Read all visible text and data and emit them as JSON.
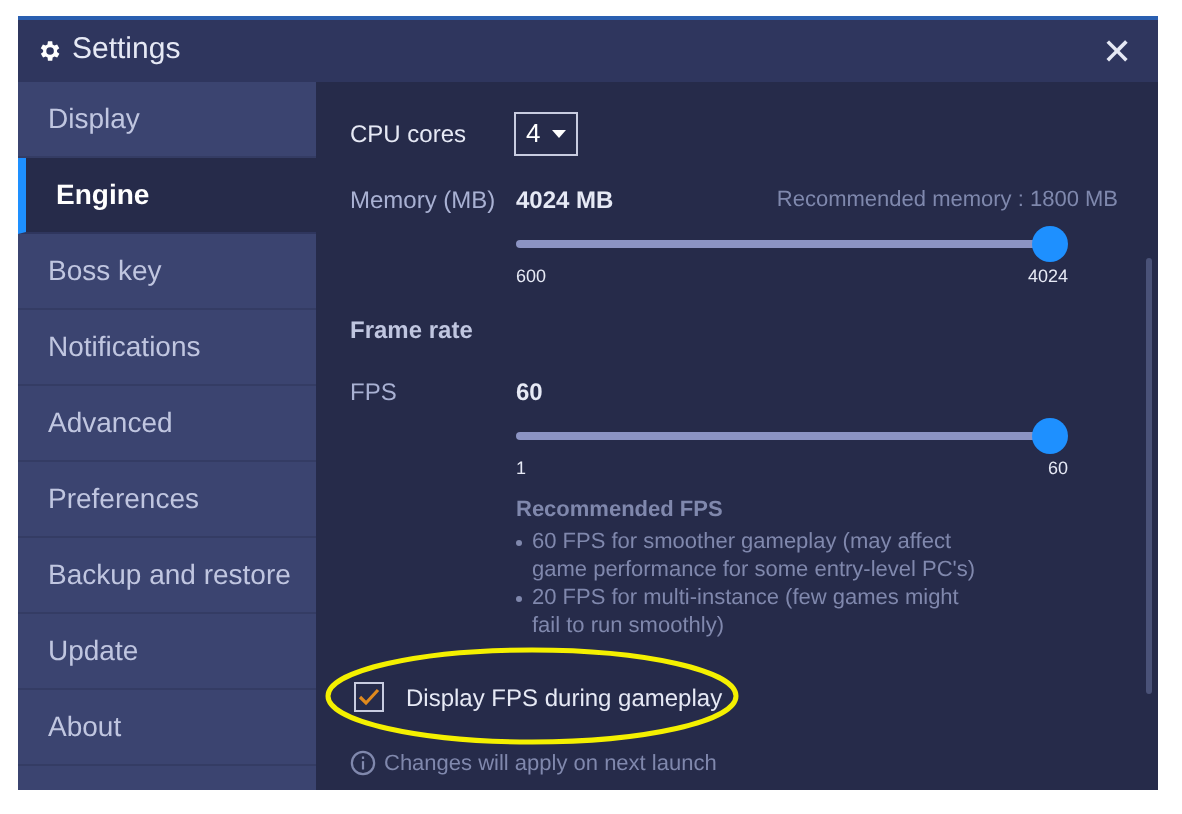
{
  "window": {
    "title": "Settings",
    "close": "✕"
  },
  "sidebar": {
    "items": [
      {
        "label": "Display",
        "selected": false
      },
      {
        "label": "Engine",
        "selected": true
      },
      {
        "label": "Boss key",
        "selected": false
      },
      {
        "label": "Notifications",
        "selected": false
      },
      {
        "label": "Advanced",
        "selected": false
      },
      {
        "label": "Preferences",
        "selected": false
      },
      {
        "label": "Backup and restore",
        "selected": false
      },
      {
        "label": "Update",
        "selected": false
      },
      {
        "label": "About",
        "selected": false
      }
    ]
  },
  "cpu": {
    "label": "CPU cores",
    "value": "4"
  },
  "memory": {
    "label": "Memory (MB)",
    "value": "4024 MB",
    "recommended": "Recommended memory : 1800 MB",
    "level": 1,
    "min": "600",
    "max": "4024"
  },
  "frame_rate": {
    "heading": "Frame rate",
    "label": "FPS",
    "value": "60",
    "level": 1,
    "min": "1",
    "max": "60"
  },
  "recommended_fps": {
    "heading": "Recommended FPS",
    "bullets": [
      "60 FPS for smoother gameplay (may affect game performance for some entry-level PC's)",
      "20 FPS for multi-instance (few games might fail to run smoothly)"
    ]
  },
  "display_fps": {
    "label": "Display FPS during gameplay",
    "checked": true
  },
  "note": "Changes will apply on next launch"
}
